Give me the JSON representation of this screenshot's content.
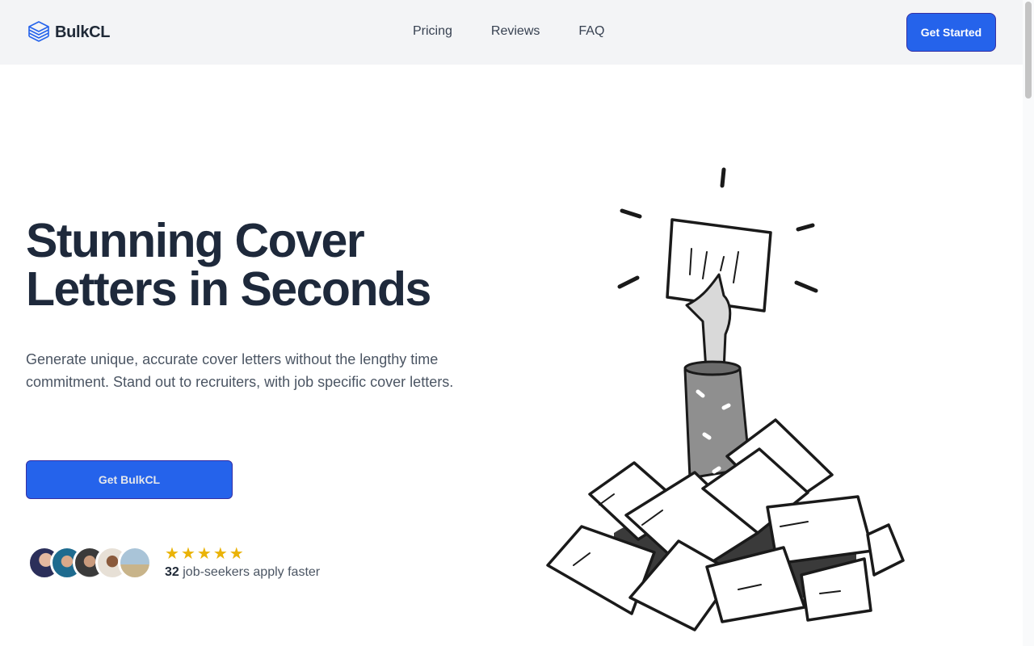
{
  "header": {
    "brand": "BulkCL",
    "nav": [
      "Pricing",
      "Reviews",
      "FAQ"
    ],
    "cta_label": "Get Started"
  },
  "hero": {
    "title_line1": "Stunning Cover",
    "title_line2": "Letters in Seconds",
    "description": "Generate unique, accurate cover letters without the lengthy time commitment. Stand out to recruiters, with job specific cover letters.",
    "cta_label": "Get BulkCL"
  },
  "social_proof": {
    "rating_stars": 5,
    "count": "32",
    "text": "job-seekers apply faster",
    "avatar_count": 5
  },
  "colors": {
    "accent": "#2563eb",
    "star": "#eab308",
    "header_bg": "#f3f4f6",
    "title": "#1e293b"
  },
  "icons": [
    "layers-logo-icon",
    "star-icon"
  ]
}
